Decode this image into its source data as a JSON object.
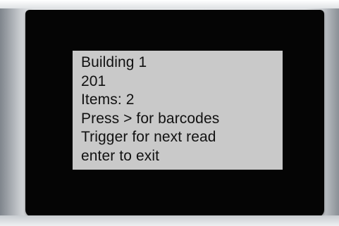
{
  "screen": {
    "lines": [
      "Building 1",
      "201",
      "Items: 2",
      "Press > for barcodes",
      "Trigger for next read",
      "enter to exit"
    ]
  },
  "colors": {
    "screen_background": "#c9c9c9",
    "screen_text": "#111111",
    "bezel": "#050505",
    "device_body": "#e9ebed"
  }
}
